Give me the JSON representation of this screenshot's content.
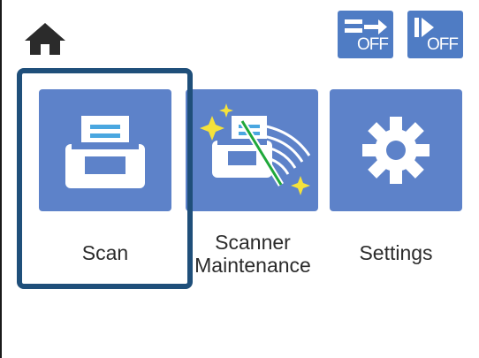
{
  "header": {
    "home_icon": "home-icon",
    "quiet_mode": {
      "icon": "quiet-mode-icon",
      "state_label": "OFF"
    },
    "auto_mode": {
      "icon": "auto-feed-mode-icon",
      "state_label": "OFF"
    }
  },
  "menu": {
    "selected_index": 0,
    "items": [
      {
        "label": "Scan",
        "icon": "scanner-icon"
      },
      {
        "label": "Scanner\nMaintenance",
        "icon": "scanner-maintenance-icon"
      },
      {
        "label": "Settings",
        "icon": "gear-icon"
      }
    ]
  },
  "colors": {
    "tile_blue": "#5d82c9",
    "status_blue": "#4f7cc4",
    "selection_border": "#1f4f7a",
    "highlight_yellow": "#f5e23a",
    "highlight_green": "#1fa83a"
  }
}
